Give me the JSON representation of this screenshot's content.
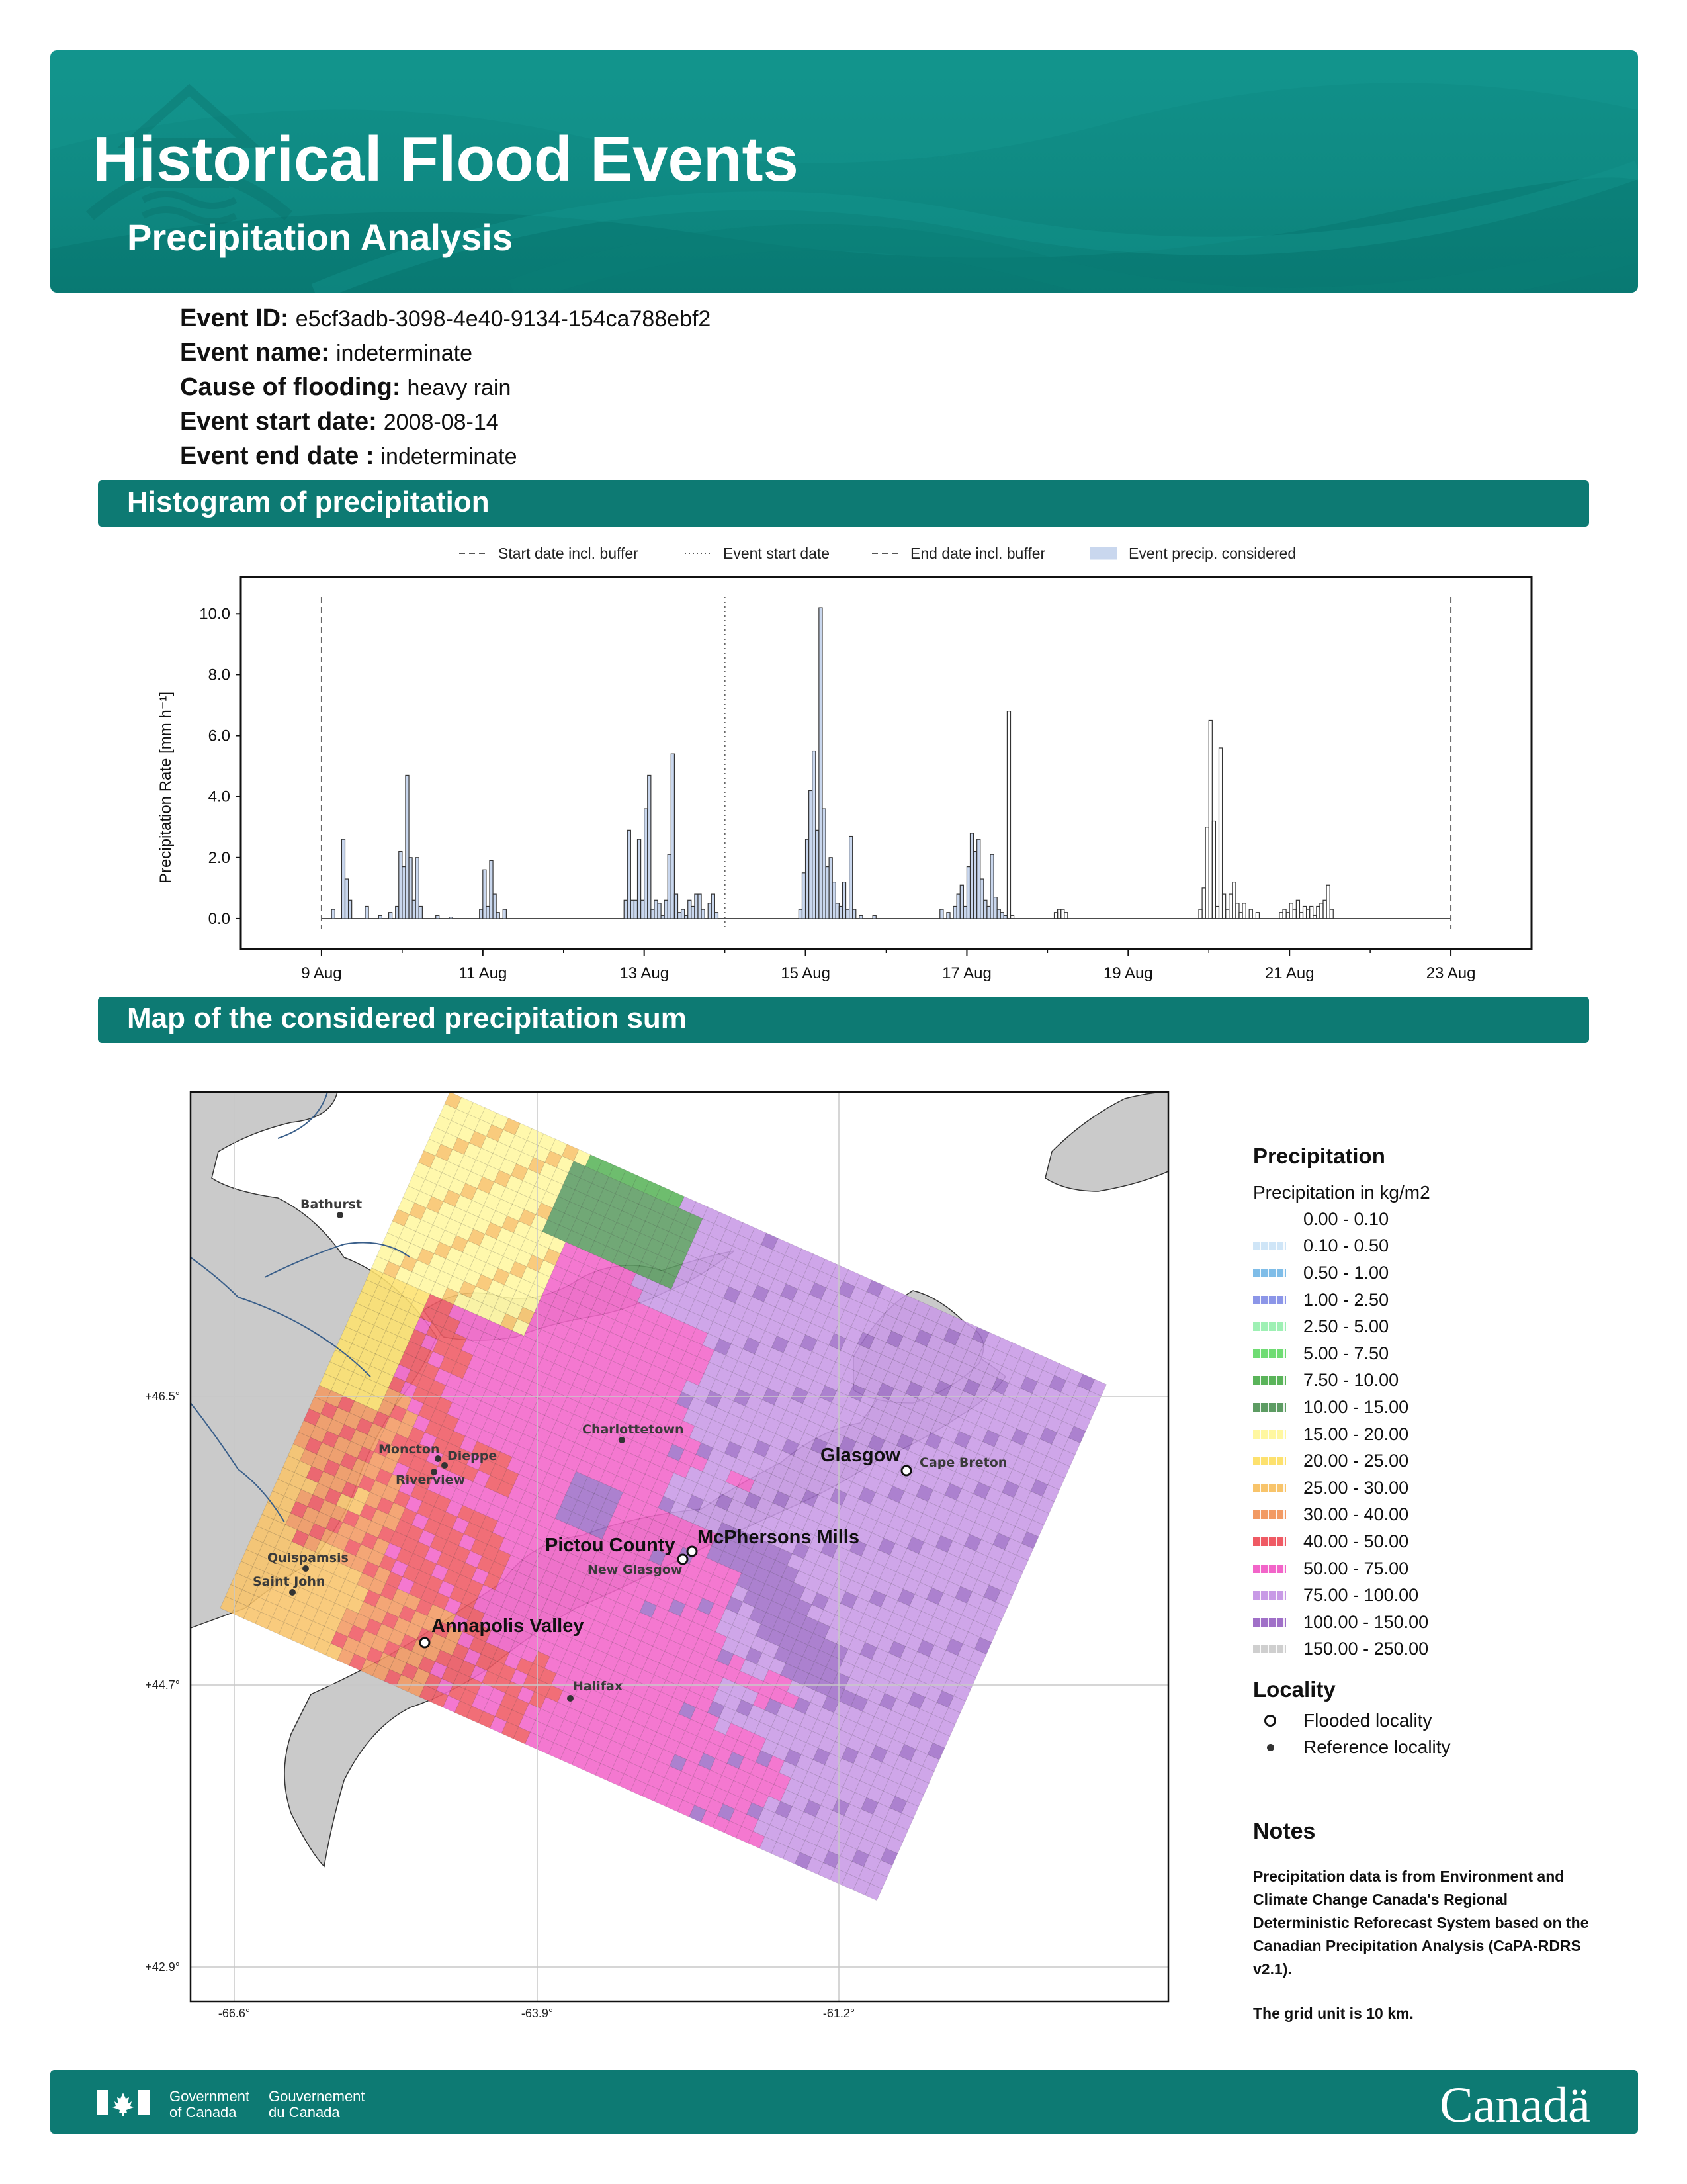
{
  "header": {
    "title": "Historical Flood Events",
    "subtitle": "Precipitation Analysis",
    "colors": {
      "banner": "#0f8a83",
      "section": "#0d7a73"
    },
    "icon": "house-flood-icon"
  },
  "event": {
    "id_label": "Event ID:",
    "id_value": "e5cf3adb-3098-4e40-9134-154ca788ebf2",
    "name_label": "Event name:",
    "name_value": "indeterminate",
    "cause_label": "Cause of flooding:",
    "cause_value": "heavy rain",
    "start_label": "Event start date:",
    "start_value": "2008-08-14",
    "end_label": "Event end date :",
    "end_value": "indeterminate"
  },
  "sections": {
    "histogram": "Histogram of precipitation",
    "map": "Map of the considered precipitation sum"
  },
  "chart_data": [
    {
      "type": "bar",
      "ylabel": "Precipitation Rate [mm h⁻¹]",
      "ylim": [
        -1.0,
        11.2
      ],
      "yticks": [
        "0.0",
        "2.0",
        "4.0",
        "6.0",
        "8.0",
        "10.0"
      ],
      "xlim_days": [
        "2008-08-08T00:00",
        "2008-08-24T00:00"
      ],
      "xticks": [
        "9 Aug",
        "11 Aug",
        "13 Aug",
        "15 Aug",
        "17 Aug",
        "19 Aug",
        "21 Aug",
        "23 Aug"
      ],
      "legend": {
        "position": "top",
        "items": [
          "Start date incl. buffer",
          "Event start date",
          "End date incl. buffer",
          "Event precip. considered"
        ]
      },
      "reference_lines": {
        "start_incl_buffer": "2008-08-09T00:00",
        "event_start": "2008-08-14T00:00",
        "end_incl_buffer": "2008-08-23T00:00"
      },
      "series": [
        {
          "name": "Event precip. considered",
          "fill": "#c9d7ee",
          "bars": [
            [
              "2008-08-09T03:00",
              0.3
            ],
            [
              "2008-08-09T06:00",
              2.6
            ],
            [
              "2008-08-09T07:00",
              1.3
            ],
            [
              "2008-08-09T08:00",
              0.6
            ],
            [
              "2008-08-09T13:00",
              0.4
            ],
            [
              "2008-08-09T17:00",
              0.1
            ],
            [
              "2008-08-09T20:00",
              0.2
            ],
            [
              "2008-08-09T22:00",
              0.4
            ],
            [
              "2008-08-09T23:00",
              2.2
            ],
            [
              "2008-08-10T00:00",
              1.7
            ],
            [
              "2008-08-10T01:00",
              4.7
            ],
            [
              "2008-08-10T02:00",
              2.0
            ],
            [
              "2008-08-10T03:00",
              0.6
            ],
            [
              "2008-08-10T04:00",
              2.0
            ],
            [
              "2008-08-10T05:00",
              0.4
            ],
            [
              "2008-08-10T10:00",
              0.1
            ],
            [
              "2008-08-10T14:00",
              0.05
            ],
            [
              "2008-08-10T23:00",
              0.3
            ],
            [
              "2008-08-11T00:00",
              1.6
            ],
            [
              "2008-08-11T01:00",
              0.4
            ],
            [
              "2008-08-11T02:00",
              1.9
            ],
            [
              "2008-08-11T03:00",
              0.8
            ],
            [
              "2008-08-11T04:00",
              0.2
            ],
            [
              "2008-08-11T06:00",
              0.3
            ],
            [
              "2008-08-12T18:00",
              0.6
            ],
            [
              "2008-08-12T19:00",
              2.9
            ],
            [
              "2008-08-12T20:00",
              0.6
            ],
            [
              "2008-08-12T21:00",
              0.6
            ],
            [
              "2008-08-12T22:00",
              2.6
            ],
            [
              "2008-08-12T23:00",
              0.6
            ],
            [
              "2008-08-13T00:00",
              3.6
            ],
            [
              "2008-08-13T01:00",
              4.7
            ],
            [
              "2008-08-13T02:00",
              0.3
            ],
            [
              "2008-08-13T03:00",
              0.6
            ],
            [
              "2008-08-13T04:00",
              0.5
            ],
            [
              "2008-08-13T05:00",
              0.1
            ],
            [
              "2008-08-13T06:00",
              0.6
            ],
            [
              "2008-08-13T07:00",
              2.1
            ],
            [
              "2008-08-13T08:00",
              5.4
            ],
            [
              "2008-08-13T09:00",
              0.8
            ],
            [
              "2008-08-13T10:00",
              0.2
            ],
            [
              "2008-08-13T11:00",
              0.3
            ],
            [
              "2008-08-13T12:00",
              0.1
            ],
            [
              "2008-08-13T13:00",
              0.6
            ],
            [
              "2008-08-13T14:00",
              0.4
            ],
            [
              "2008-08-13T15:00",
              0.8
            ],
            [
              "2008-08-13T16:00",
              0.8
            ],
            [
              "2008-08-13T17:00",
              0.3
            ],
            [
              "2008-08-13T19:00",
              0.5
            ],
            [
              "2008-08-13T20:00",
              0.8
            ],
            [
              "2008-08-13T21:00",
              0.2
            ],
            [
              "2008-08-14T22:00",
              0.3
            ],
            [
              "2008-08-14T23:00",
              1.5
            ],
            [
              "2008-08-15T00:00",
              2.6
            ],
            [
              "2008-08-15T01:00",
              4.2
            ],
            [
              "2008-08-15T02:00",
              5.5
            ],
            [
              "2008-08-15T03:00",
              2.9
            ],
            [
              "2008-08-15T04:00",
              10.2
            ],
            [
              "2008-08-15T05:00",
              3.6
            ],
            [
              "2008-08-15T06:00",
              1.7
            ],
            [
              "2008-08-15T07:00",
              2.0
            ],
            [
              "2008-08-15T08:00",
              1.2
            ],
            [
              "2008-08-15T09:00",
              0.5
            ],
            [
              "2008-08-15T10:00",
              0.4
            ],
            [
              "2008-08-15T11:00",
              1.2
            ],
            [
              "2008-08-15T12:00",
              0.3
            ],
            [
              "2008-08-15T13:00",
              2.7
            ],
            [
              "2008-08-15T14:00",
              0.3
            ],
            [
              "2008-08-15T16:00",
              0.1
            ],
            [
              "2008-08-15T20:00",
              0.1
            ],
            [
              "2008-08-16T16:00",
              0.3
            ],
            [
              "2008-08-16T18:00",
              0.2
            ],
            [
              "2008-08-16T20:00",
              0.4
            ],
            [
              "2008-08-16T21:00",
              0.8
            ],
            [
              "2008-08-16T22:00",
              1.1
            ],
            [
              "2008-08-16T23:00",
              0.4
            ],
            [
              "2008-08-17T00:00",
              1.7
            ],
            [
              "2008-08-17T01:00",
              2.8
            ],
            [
              "2008-08-17T02:00",
              2.2
            ],
            [
              "2008-08-17T03:00",
              2.6
            ],
            [
              "2008-08-17T04:00",
              1.3
            ],
            [
              "2008-08-17T05:00",
              0.6
            ],
            [
              "2008-08-17T06:00",
              0.4
            ],
            [
              "2008-08-17T07:00",
              2.1
            ],
            [
              "2008-08-17T08:00",
              0.7
            ],
            [
              "2008-08-17T09:00",
              0.3
            ],
            [
              "2008-08-17T10:00",
              0.2
            ],
            [
              "2008-08-17T11:00",
              0.1
            ]
          ]
        },
        {
          "name": "Outside event (outline)",
          "fill": "none",
          "bars": [
            [
              "2008-08-17T12:00",
              6.8
            ],
            [
              "2008-08-17T13:00",
              0.1
            ],
            [
              "2008-08-18T02:00",
              0.2
            ],
            [
              "2008-08-18T03:00",
              0.3
            ],
            [
              "2008-08-18T04:00",
              0.3
            ],
            [
              "2008-08-18T05:00",
              0.2
            ],
            [
              "2008-08-19T21:00",
              0.3
            ],
            [
              "2008-08-19T22:00",
              1.0
            ],
            [
              "2008-08-19T23:00",
              3.0
            ],
            [
              "2008-08-20T00:00",
              6.5
            ],
            [
              "2008-08-20T01:00",
              3.2
            ],
            [
              "2008-08-20T02:00",
              0.4
            ],
            [
              "2008-08-20T03:00",
              5.6
            ],
            [
              "2008-08-20T04:00",
              0.8
            ],
            [
              "2008-08-20T05:00",
              0.3
            ],
            [
              "2008-08-20T06:00",
              0.8
            ],
            [
              "2008-08-20T07:00",
              1.2
            ],
            [
              "2008-08-20T08:00",
              0.5
            ],
            [
              "2008-08-20T09:00",
              0.2
            ],
            [
              "2008-08-20T10:00",
              0.5
            ],
            [
              "2008-08-20T12:00",
              0.3
            ],
            [
              "2008-08-20T14:00",
              0.2
            ],
            [
              "2008-08-20T21:00",
              0.2
            ],
            [
              "2008-08-20T22:00",
              0.3
            ],
            [
              "2008-08-20T23:00",
              0.2
            ],
            [
              "2008-08-21T00:00",
              0.5
            ],
            [
              "2008-08-21T01:00",
              0.3
            ],
            [
              "2008-08-21T02:00",
              0.6
            ],
            [
              "2008-08-21T03:00",
              0.2
            ],
            [
              "2008-08-21T04:00",
              0.4
            ],
            [
              "2008-08-21T05:00",
              0.3
            ],
            [
              "2008-08-21T06:00",
              0.4
            ],
            [
              "2008-08-21T07:00",
              0.1
            ],
            [
              "2008-08-21T08:00",
              0.4
            ],
            [
              "2008-08-21T09:00",
              0.5
            ],
            [
              "2008-08-21T10:00",
              0.6
            ],
            [
              "2008-08-21T11:00",
              1.1
            ],
            [
              "2008-08-21T12:00",
              0.3
            ]
          ]
        }
      ]
    },
    {
      "type": "heatmap",
      "lon_ticks": [
        "-66.6°",
        "-63.9°",
        "-61.2°"
      ],
      "lat_ticks": [
        "+46.5°",
        "+44.7°",
        "+42.9°"
      ],
      "flooded_localities": [
        {
          "name": "Glasgow",
          "lon": -61.6,
          "lat": 46.1
        },
        {
          "name": "McPhersons Mills",
          "lon": -62.6,
          "lat": 45.55
        },
        {
          "name": "Pictou County",
          "lon": -62.7,
          "lat": 45.5
        },
        {
          "name": "Annapolis Valley",
          "lon": -64.9,
          "lat": 44.9
        }
      ],
      "reference_localities": [
        {
          "name": "Bathurst",
          "lon": -65.65,
          "lat": 47.6
        },
        {
          "name": "Charlottetown",
          "lon": -63.12,
          "lat": 46.24
        },
        {
          "name": "Cape Breton",
          "lon": -60.5,
          "lat": 46.1
        },
        {
          "name": "Moncton",
          "lon": -64.78,
          "lat": 46.09
        },
        {
          "name": "Dieppe",
          "lon": -64.69,
          "lat": 46.07
        },
        {
          "name": "Riverview",
          "lon": -64.8,
          "lat": 46.02
        },
        {
          "name": "Quispamsis",
          "lon": -65.95,
          "lat": 45.43
        },
        {
          "name": "Saint John",
          "lon": -66.06,
          "lat": 45.27
        },
        {
          "name": "New Glasgow",
          "lon": -62.65,
          "lat": 45.58
        },
        {
          "name": "Halifax",
          "lon": -63.57,
          "lat": 44.65
        }
      ]
    }
  ],
  "legend": {
    "title": "Precipitation",
    "subtitle": "Precipitation in kg/m2",
    "classes": [
      {
        "label": "0.00 - 0.10",
        "color": "#ffffff"
      },
      {
        "label": "0.10 - 0.50",
        "color": "#cfe5f7"
      },
      {
        "label": "0.50 - 1.00",
        "color": "#7fbde8"
      },
      {
        "label": "1.00 - 2.50",
        "color": "#8c96e8"
      },
      {
        "label": "2.50 - 5.00",
        "color": "#9ef0b4"
      },
      {
        "label": "5.00 - 7.50",
        "color": "#6fdc73"
      },
      {
        "label": "7.50 - 10.00",
        "color": "#5ab45a"
      },
      {
        "label": "10.00 - 15.00",
        "color": "#5d9c63"
      },
      {
        "label": "15.00 - 20.00",
        "color": "#fff7a0"
      },
      {
        "label": "20.00 - 25.00",
        "color": "#fde16e"
      },
      {
        "label": "25.00 - 30.00",
        "color": "#f8c46b"
      },
      {
        "label": "30.00 - 40.00",
        "color": "#f29a63"
      },
      {
        "label": "40.00 - 50.00",
        "color": "#ef5a64"
      },
      {
        "label": "50.00 - 75.00",
        "color": "#f265c9"
      },
      {
        "label": "75.00 - 100.00",
        "color": "#c89ae6"
      },
      {
        "label": "100.00 - 150.00",
        "color": "#a070c8"
      },
      {
        "label": "150.00 - 250.00",
        "color": "#cfcfcf"
      }
    ],
    "locality_title": "Locality",
    "flooded_label": "Flooded locality",
    "reference_label": "Reference locality"
  },
  "notes": {
    "title": "Notes",
    "paragraph1": "Precipitation data is from Environment and Climate Change Canada's Regional Deterministic Reforecast System based on the Canadian Precipitation Analysis (CaPA-RDRS v2.1).",
    "paragraph2": "The grid unit is 10 km."
  },
  "footer": {
    "gov_en": "Government\nof Canada",
    "gov_fr": "Gouvernement\ndu Canada",
    "wordmark": "Canadä",
    "flag_icon": "canada-flag-icon"
  }
}
